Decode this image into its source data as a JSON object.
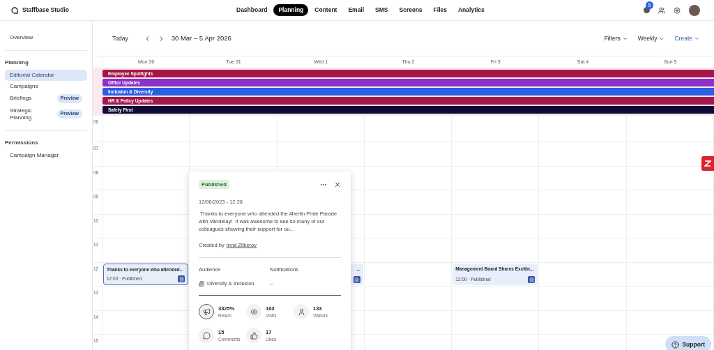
{
  "app": {
    "name": "Staffbase Studio"
  },
  "nav": [
    {
      "label": "Dashboard",
      "selected": false
    },
    {
      "label": "Planning",
      "selected": true
    },
    {
      "label": "Content",
      "selected": false
    },
    {
      "label": "Email",
      "selected": false
    },
    {
      "label": "SMS",
      "selected": false
    },
    {
      "label": "Screens",
      "selected": false
    },
    {
      "label": "Files",
      "selected": false
    },
    {
      "label": "Analytics",
      "selected": false
    }
  ],
  "notifications": {
    "count": "5"
  },
  "sidebar": {
    "sections": [
      {
        "items": [
          {
            "label": "Overview",
            "selected": false
          }
        ]
      },
      {
        "heading": "Planning",
        "items": [
          {
            "label": "Editorial Calendar",
            "selected": true
          },
          {
            "label": "Campaigns",
            "selected": false
          },
          {
            "label": "Briefings",
            "badge": "Preview",
            "selected": false
          },
          {
            "label": "Strategic Planning",
            "badge": "Preview",
            "selected": false
          }
        ]
      },
      {
        "heading": "Permissions",
        "items": [
          {
            "label": "Campaign Manager",
            "selected": false
          }
        ]
      }
    ]
  },
  "toolbar": {
    "today": "Today",
    "range": "30 Mar – 5 Apr 2026",
    "filters": "Filters",
    "view": "Weekly",
    "create": "Create"
  },
  "days": [
    {
      "label": "Mon 30",
      "event": {
        "title": "Thanks to everyone who attended...",
        "time": "12:00 · Published",
        "selected": true
      }
    },
    {
      "label": "Tue 31"
    },
    {
      "label": "Wed 1",
      "event": {
        "title": "...",
        "selected": false
      }
    },
    {
      "label": "Thu 2"
    },
    {
      "label": "Fri 3",
      "event": {
        "title": "Management Board Shares Excitin...",
        "time": "12:00 · Published",
        "selected": false
      }
    },
    {
      "label": "Sat 4"
    },
    {
      "label": "Sun 5"
    }
  ],
  "campaigns": [
    {
      "name": "Employee Spotlights",
      "color": "#a3174a"
    },
    {
      "name": "Office Updates",
      "color": "#8b30c9"
    },
    {
      "name": "Inclusion & Diversity",
      "color": "#2a5ee3"
    },
    {
      "name": "HR & Policy Updates",
      "color": "#a3174a"
    },
    {
      "name": "Safety First",
      "color": "#100a36"
    }
  ],
  "hours": [
    "06",
    "07",
    "08",
    "09",
    "10",
    "11",
    "12",
    "13",
    "14",
    "15"
  ],
  "popup": {
    "status": "Published",
    "date": "12/06/2023 - 12:28",
    "text": " Thanks to everyone who attended the #berlin Pride Parade with Vandelay!  It was awesome to see so many of our colleagues showing their support for ou...",
    "created_by": "Created by",
    "author": "Inna Zilberov",
    "audience_label": "Audience",
    "audience": "Diversity & Inclusion",
    "notifications_label": "Notifications",
    "notifications": "–",
    "stats": [
      {
        "kind": "reach",
        "value": "3325%",
        "label": "Reach"
      },
      {
        "kind": "visits",
        "value": "163",
        "label": "Visits"
      },
      {
        "kind": "visitors",
        "value": "133",
        "label": "Visitors"
      },
      {
        "kind": "comments",
        "value": "15",
        "label": "Comments"
      },
      {
        "kind": "likes",
        "value": "17",
        "label": "Likes"
      }
    ]
  },
  "support": "Support"
}
